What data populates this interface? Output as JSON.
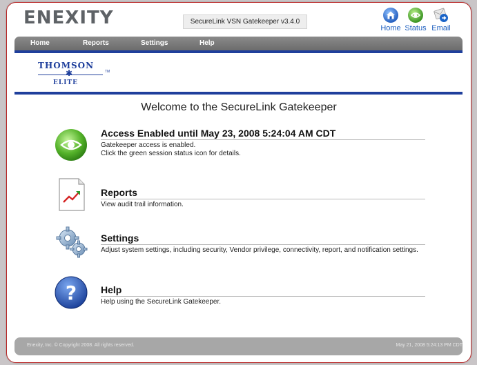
{
  "header": {
    "logo": "ENEXITY",
    "version": "SecureLink VSN Gatekeeper v3.4.0",
    "icons": [
      {
        "label": "Home",
        "icon": "home-icon",
        "color": "#1a64c8"
      },
      {
        "label": "Status",
        "icon": "status-icon",
        "color": "#3a9b1f"
      },
      {
        "label": "Email",
        "icon": "email-icon",
        "color": "#1a64c8"
      }
    ]
  },
  "nav": {
    "items": [
      "Home",
      "Reports",
      "Settings",
      "Help"
    ]
  },
  "brand": {
    "line1": "THOMSON",
    "line2": "ELITE",
    "tm": "TM"
  },
  "welcome": "Welcome to the SecureLink Gatekeeper",
  "sections": {
    "access": {
      "title": "Access Enabled until May 23, 2008 5:24:04 AM CDT",
      "desc": "Gatekeeper access is enabled.",
      "desc2": "Click the green session status icon for details."
    },
    "reports": {
      "title": "Reports",
      "desc": "View audit trail information."
    },
    "settings": {
      "title": "Settings",
      "desc": "Adjust system settings, including security, Vendor privilege, connectivity, report, and notification settings."
    },
    "help": {
      "title": "Help",
      "desc": "Help using the SecureLink Gatekeeper."
    }
  },
  "footer": {
    "copyright": "Enexity, Inc. © Copyright 2008. All rights reserved.",
    "timestamp": "May 21, 2008 5:24:13 PM CDT"
  },
  "colors": {
    "accent_blue": "#1f3f9c",
    "frame_red": "#b82626",
    "nav_gray": "#7a7a7a"
  }
}
